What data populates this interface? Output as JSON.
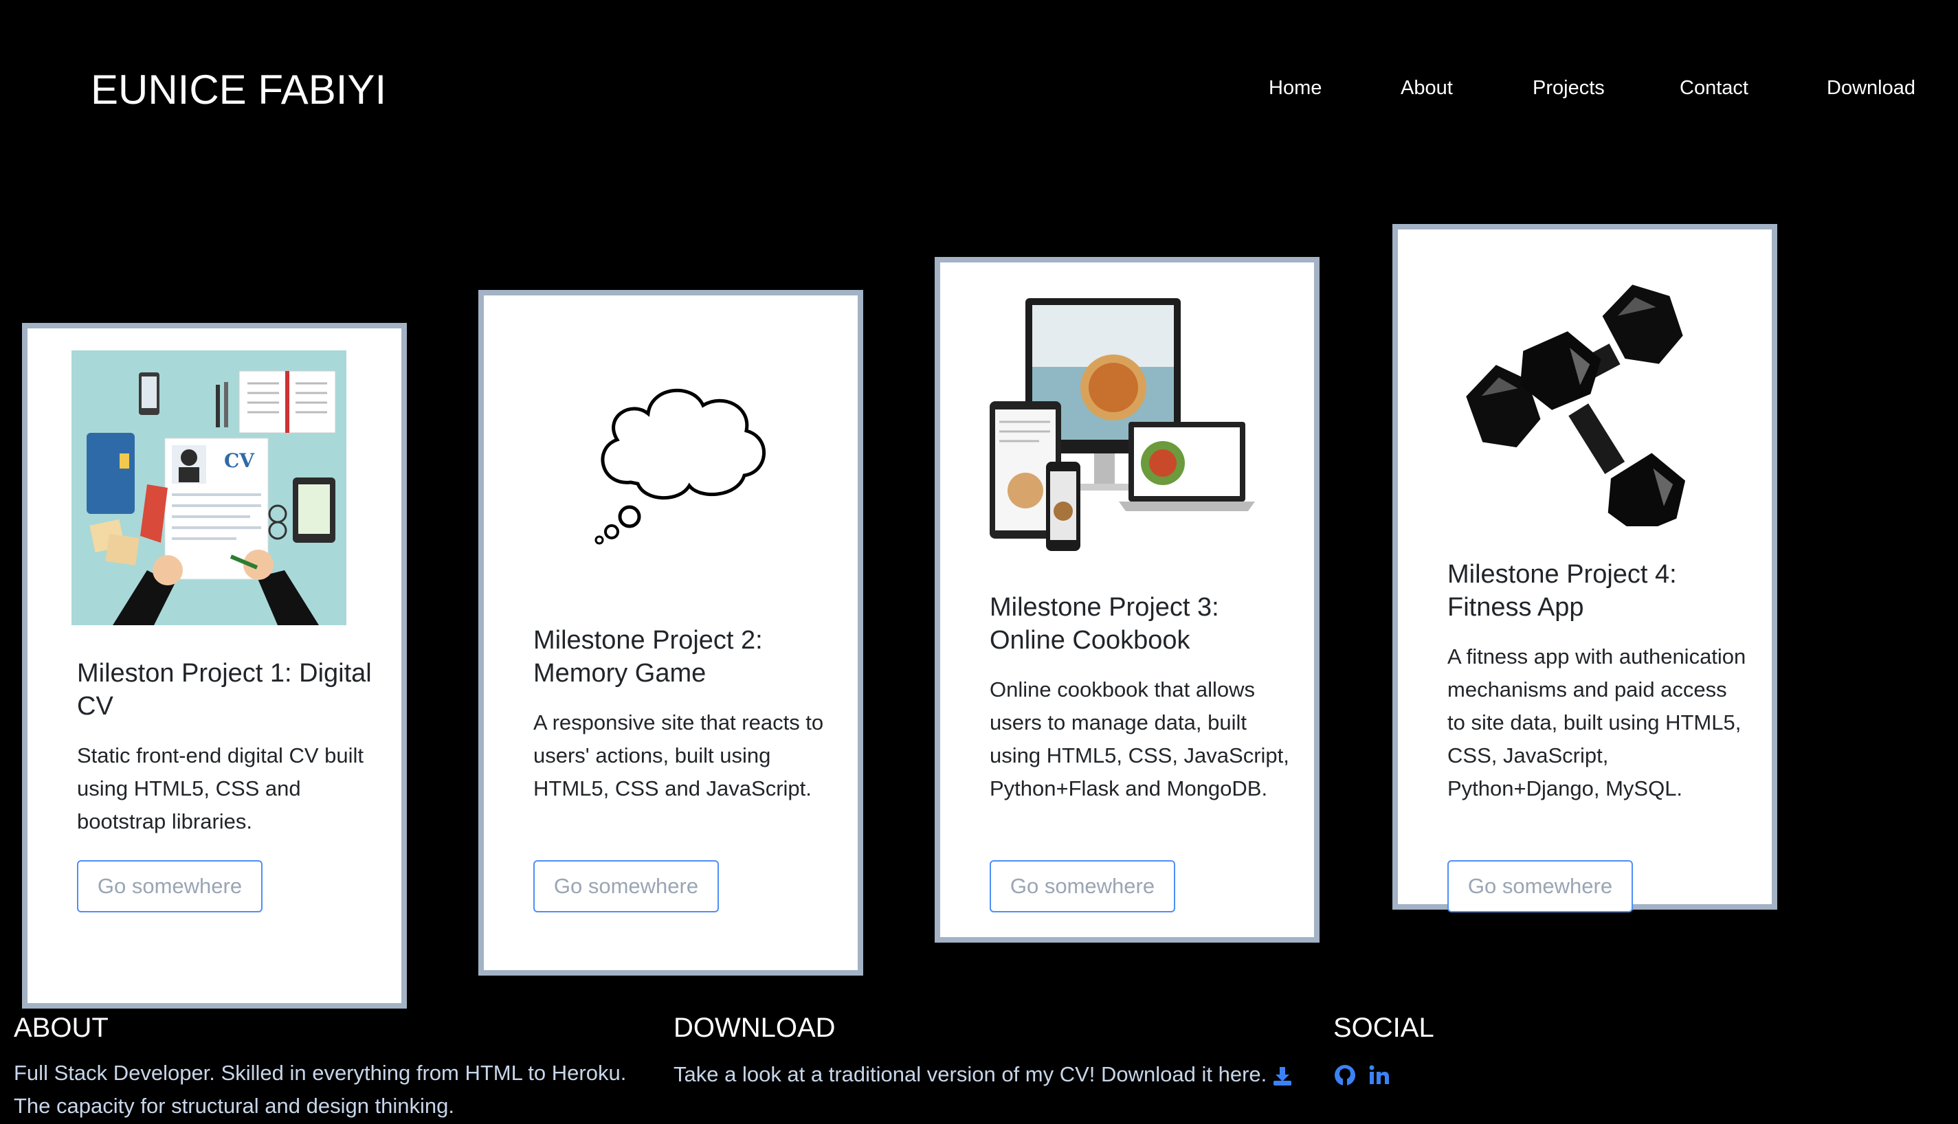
{
  "header": {
    "brand": "EUNICE FABIYI",
    "nav": [
      {
        "label": "Home"
      },
      {
        "label": "About"
      },
      {
        "label": "Projects"
      },
      {
        "label": "Contact"
      },
      {
        "label": "Download"
      }
    ]
  },
  "projects": [
    {
      "image_icon": "cv-illustration-icon",
      "title": "Mileston Project 1: Digital CV",
      "text": "Static front-end digital CV built using HTML5, CSS and bootstrap libraries.",
      "button": "Go somewhere"
    },
    {
      "image_icon": "thought-cloud-icon",
      "title": "Milestone Project 2: Memory Game",
      "text": "A responsive site that reacts to users' actions, built using HTML5, CSS and JavaScript.",
      "button": "Go somewhere"
    },
    {
      "image_icon": "responsive-devices-icon",
      "title": "Milestone Project 3: Online Cookbook",
      "text": "Online cookbook that allows users to manage data, built using HTML5, CSS, JavaScript, Python+Flask and MongoDB.",
      "button": "Go somewhere"
    },
    {
      "image_icon": "dumbbells-icon",
      "title": "Milestone Project 4: Fitness App",
      "text": "A fitness app with authenication mechanisms and paid access to site data, built using HTML5, CSS, JavaScript, Python+Django, MySQL.",
      "button": "Go somewhere"
    }
  ],
  "footer": {
    "about": {
      "heading": "ABOUT",
      "line1": "Full Stack Developer. Skilled in everything from HTML to Heroku.",
      "line2": "The capacity for structural and design thinking."
    },
    "download": {
      "heading": "DOWNLOAD",
      "text": "Take a look at a traditional version of my CV! Download it here.",
      "icon": "download-icon"
    },
    "social": {
      "heading": "SOCIAL",
      "icons": [
        "github-icon",
        "linkedin-icon"
      ]
    }
  },
  "colors": {
    "background": "#000000",
    "card_border": "#a3b2c5",
    "button_border": "#4d8ff7",
    "link_blue": "#3b82f6",
    "footer_text": "#c8d6ea"
  }
}
